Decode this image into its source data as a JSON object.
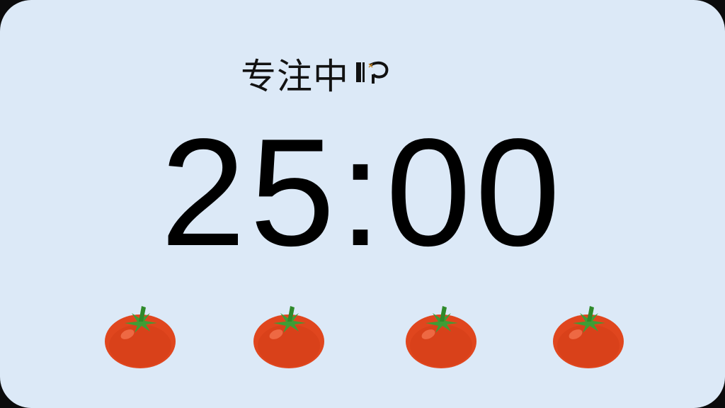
{
  "status": {
    "label": "专注中",
    "icon": "timer-icon"
  },
  "timer": {
    "display": "25:00"
  },
  "session": {
    "completed": 4,
    "icon": "tomato-icon"
  },
  "colors": {
    "background": "#dce9f7",
    "text": "#000000",
    "tomato": "#e0461e",
    "leaf": "#3f9c35"
  }
}
